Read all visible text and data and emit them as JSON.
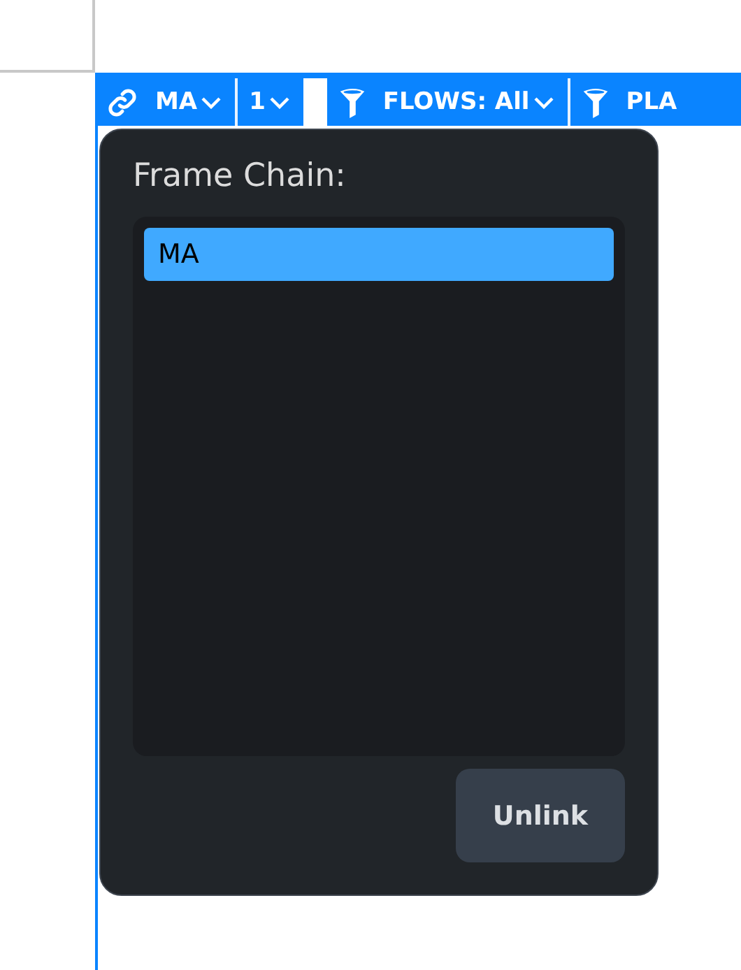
{
  "toolbar": {
    "items": [
      {
        "kind": "link",
        "label": "MA",
        "caret": true
      },
      {
        "kind": "divider"
      },
      {
        "kind": "plain",
        "label": "1",
        "caret": true
      },
      {
        "kind": "swatch"
      },
      {
        "kind": "filter",
        "label": "FLOWS: All",
        "caret": true
      },
      {
        "kind": "divider"
      },
      {
        "kind": "filter",
        "label": "PLA",
        "caret": false
      }
    ]
  },
  "popup": {
    "title": "Frame Chain:",
    "items": [
      {
        "label": "MA",
        "selected": true
      }
    ],
    "button": "Unlink"
  }
}
